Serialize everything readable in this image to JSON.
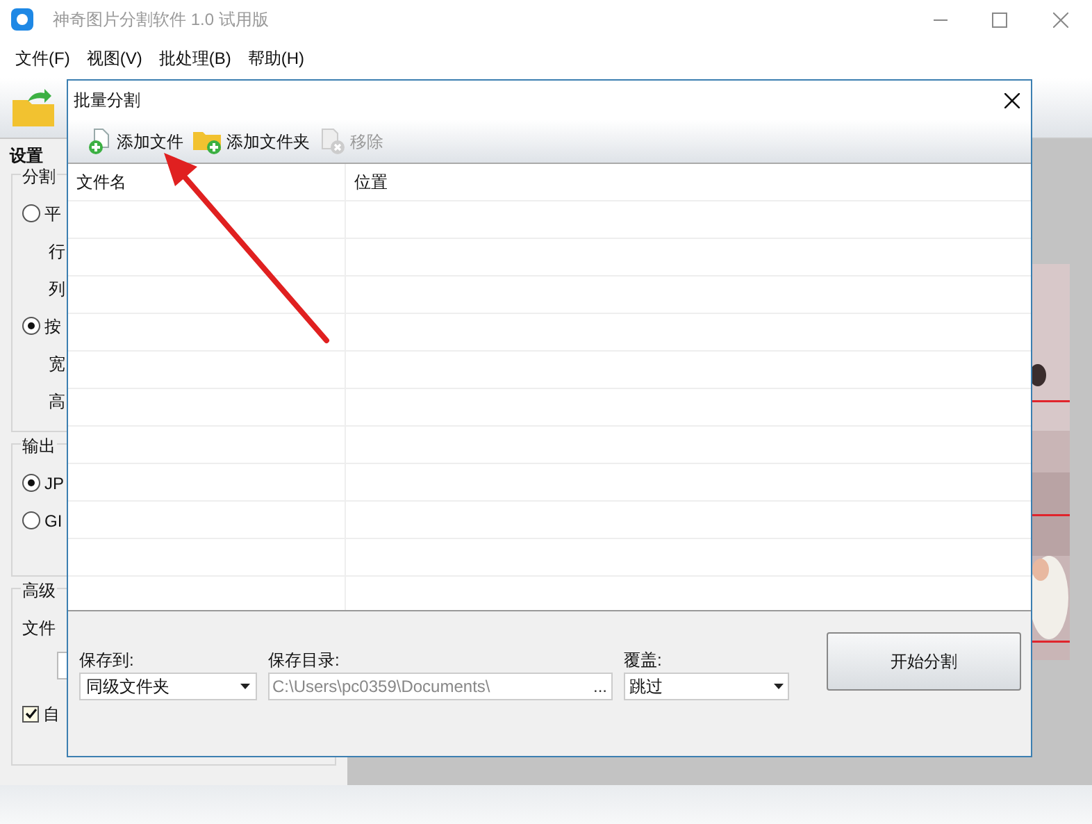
{
  "window": {
    "title": "神奇图片分割软件 1.0 试用版"
  },
  "menu": [
    "文件(F)",
    "视图(V)",
    "批处理(B)",
    "帮助(H)"
  ],
  "settings": {
    "title": "设置",
    "groups": [
      {
        "legend": "分割",
        "items": [
          {
            "kind": "radio",
            "label": "平",
            "selected": false
          },
          {
            "kind": "label",
            "label": "行"
          },
          {
            "kind": "label",
            "label": "列"
          },
          {
            "kind": "radio",
            "label": "按",
            "selected": true
          },
          {
            "kind": "label",
            "label": "宽"
          },
          {
            "kind": "label",
            "label": "高"
          }
        ]
      },
      {
        "legend": "输出",
        "items": [
          {
            "kind": "radio",
            "label": "JP",
            "selected": true
          },
          {
            "kind": "radio",
            "label": "GI",
            "selected": false
          }
        ]
      },
      {
        "legend": "高级",
        "items": [
          {
            "kind": "caption",
            "label": "文件"
          },
          {
            "kind": "field"
          },
          {
            "kind": "checkbox",
            "label": "自",
            "checked": true
          }
        ]
      }
    ]
  },
  "dialog": {
    "title": "批量分割",
    "toolbar": [
      {
        "kind": "file",
        "label": "添加文件",
        "disabled": false
      },
      {
        "kind": "folder",
        "label": "添加文件夹",
        "disabled": false
      },
      {
        "kind": "remove",
        "label": "移除",
        "disabled": true
      }
    ],
    "columns": [
      "文件名",
      "位置"
    ],
    "save_to": {
      "label": "保存到:",
      "value": "同级文件夹"
    },
    "save_dir": {
      "label": "保存目录:",
      "value": "C:\\Users\\pc0359\\Documents\\",
      "browse": "...",
      "disabled": true
    },
    "overwrite": {
      "label": "覆盖:",
      "value": "跳过"
    },
    "start_button": "开始分割"
  }
}
